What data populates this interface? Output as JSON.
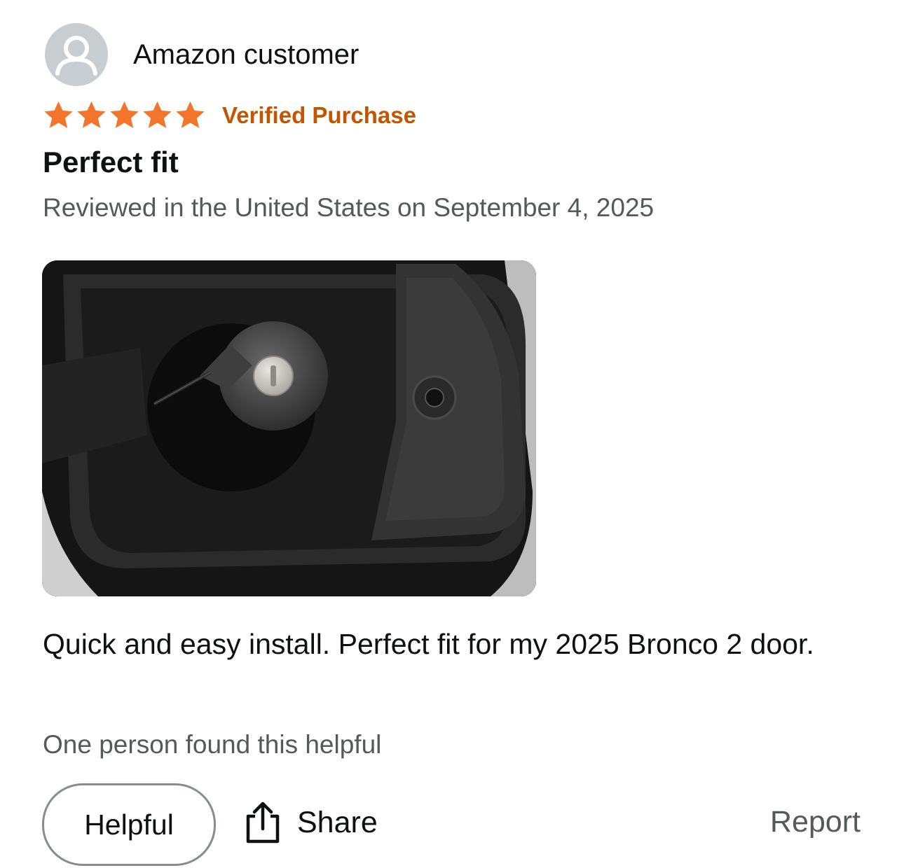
{
  "review": {
    "reviewer_name": "Amazon customer",
    "avatar_icon": "user-silhouette-icon",
    "rating": 5,
    "rating_max": 5,
    "star_icon": "star-icon",
    "verified_label": "Verified Purchase",
    "title": "Perfect fit",
    "date_text": "Reviewed in the United States on September 4, 2025",
    "body": "Quick and easy install. Perfect fit for my 2025 Bronco 2 door.",
    "helpful_count_text": "One person found this helpful"
  },
  "actions": {
    "helpful_label": "Helpful",
    "share_label": "Share",
    "share_icon": "share-icon",
    "report_label": "Report"
  },
  "colors": {
    "star": "#f3742b",
    "verified": "#c45500",
    "secondary_text": "#565959",
    "primary_text": "#0f1111",
    "avatar_bg": "#c7cdd0"
  }
}
